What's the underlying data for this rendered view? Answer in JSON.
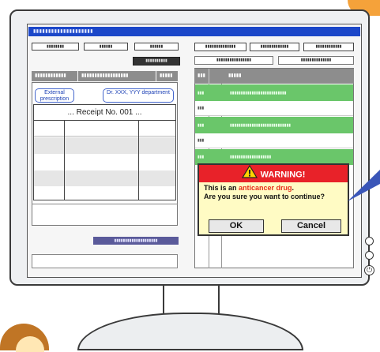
{
  "screen": {
    "title_bar_text": "▮▮▮▮▮▮▮▮▮▮▮▮▮▮▮▮▮▮▮▮",
    "toolbar_buttons": [
      "▮▮▮▮▮▮▮▮",
      "▮▮▮▮▮▮",
      "▮▮▮▮▮▮"
    ],
    "dark_button": "▮▮▮▮▮▮▮▮▮▮",
    "right_top_buttons": [
      "▮▮▮▮▮▮▮▮▮▮▮▮▮▮",
      "▮▮▮▮▮▮▮▮▮▮▮▮▮",
      "▮▮▮▮▮▮▮▮▮▮▮▮"
    ],
    "right_sub_buttons": [
      "▮▮▮▮▮▮▮▮▮▮▮▮▮▮▮▮",
      "▮▮▮▮▮▮▮▮▮▮▮▮▮▮"
    ],
    "left_header_cells": [
      "▮▮▮▮▮▮▮▮▮▮▮▮",
      "▮▮▮▮▮▮▮▮▮▮▮▮▮▮▮▮▮▮",
      "▮▮▮▮▮"
    ],
    "tab_external": "External prescription",
    "tab_doctor": "Dr. XXX, YYY department",
    "receipt_label": "... Receipt No. 001 ...",
    "bottom_button": "▮▮▮▮▮▮▮▮▮▮▮▮▮▮▮▮▮▮▮▮",
    "right_header_cells": [
      "▮▮▮",
      "▮▮▮▮▮"
    ],
    "right_rows": [
      {
        "left": "▮▮▮",
        "text": "▮▮▮▮▮▮▮▮▮▮▮▮▮▮▮▮▮▮▮▮▮▮▮▮▮▮",
        "green": true
      },
      {
        "left": "▮▮▮",
        "text": "",
        "green": false
      },
      {
        "left": "▮▮▮",
        "text": "▮▮▮▮▮▮▮▮▮▮▮▮▮▮▮▮▮▮▮▮▮▮▮▮▮▮▮▮",
        "green": true
      },
      {
        "left": "▮▮▮",
        "text": "",
        "green": false
      },
      {
        "left": "▮▮▮",
        "text": "▮▮▮▮▮▮▮▮▮▮▮▮▮▮▮▮▮▮▮",
        "green": true
      }
    ]
  },
  "warning": {
    "title": "WARNING!",
    "line1_prefix": "This is an ",
    "line1_highlight": "anticancer drug",
    "line1_suffix": ".",
    "line2": "Are you sure you want to continue?",
    "ok": "OK",
    "cancel": "Cancel"
  },
  "colors": {
    "title_bar": "#1b47c9",
    "row_highlight": "#6ac66a",
    "warning_header": "#e82229",
    "warning_body": "#fffbc4",
    "accent_orange": "#f5a23a"
  }
}
